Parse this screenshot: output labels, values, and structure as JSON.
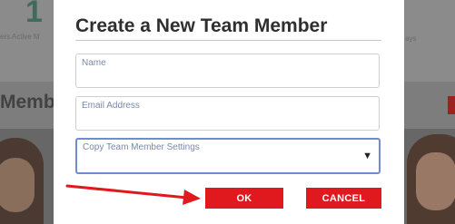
{
  "background": {
    "stat_number": "1",
    "stat_label_left": "ers Active M",
    "stat_label_right": "ays",
    "section_partial": "Membe"
  },
  "modal": {
    "title": "Create a New Team Member",
    "fields": {
      "name": {
        "label": "Name",
        "value": ""
      },
      "email": {
        "label": "Email Address",
        "value": ""
      },
      "copy_settings": {
        "label": "Copy Team Member Settings",
        "selected": ""
      }
    },
    "buttons": {
      "ok": "OK",
      "cancel": "CANCEL"
    }
  },
  "annotation": {
    "arrow_color": "#e0191f",
    "points_to": "ok-button"
  },
  "colors": {
    "accent_button": "#e0191f",
    "focus_border": "#6f8bd4",
    "overlay": "#7d7d7d"
  }
}
